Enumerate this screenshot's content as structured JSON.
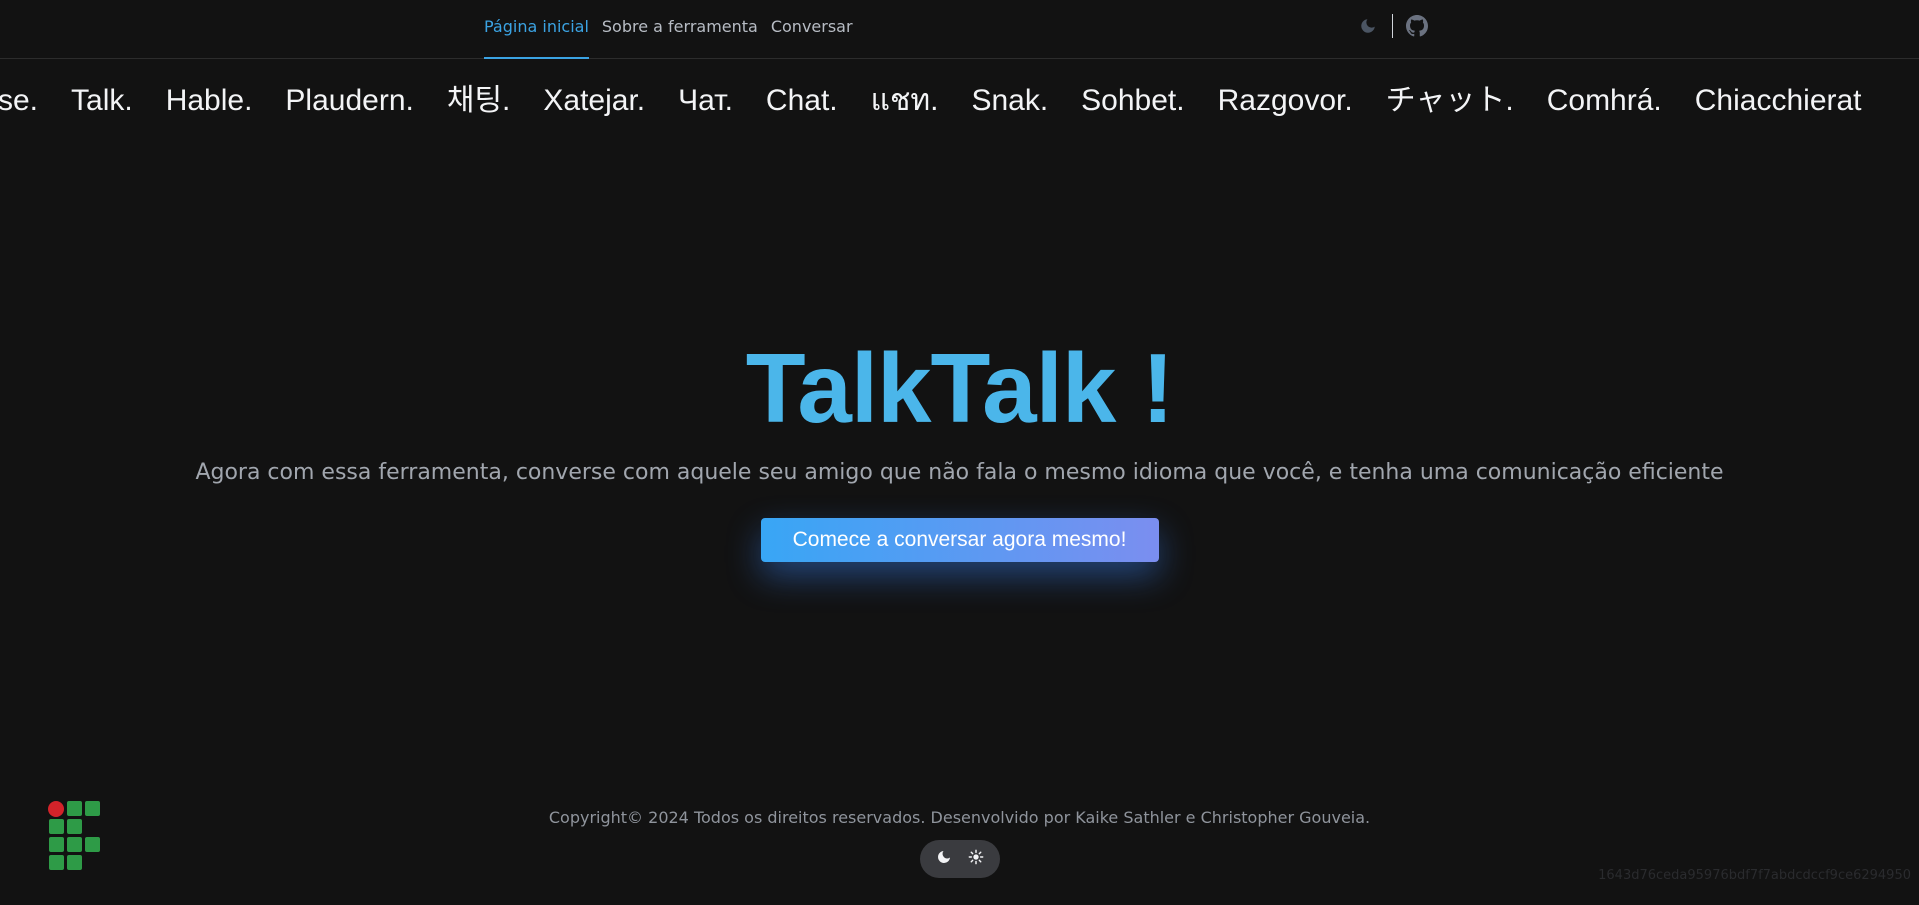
{
  "nav": {
    "links": [
      "Página inicial",
      "Sobre a ferramenta",
      "Conversar"
    ],
    "active_index": 0,
    "right_icons": [
      "moon-icon",
      "github-icon"
    ]
  },
  "marquee": {
    "words": [
      "rse.",
      "Talk.",
      "Hable.",
      "Plaudern.",
      "채팅.",
      "Xatejar.",
      "Чат.",
      "Chat.",
      "แชท.",
      "Snak.",
      "Sohbet.",
      "Razgovor.",
      "チャット.",
      "Comhrá.",
      "Chiacchierat"
    ]
  },
  "hero": {
    "title": "TalkTalk !",
    "subtitle": "Agora com essa ferramenta, converse com aquele seu amigo que não fala o mesmo idioma que você, e tenha uma comunicação eficiente",
    "cta_label": "Comece a conversar agora mesmo!"
  },
  "footer": {
    "copyright": "Copyright© 2024 Todos os direitos reservados. Desenvolvido por Kaike Sathler e Christopher Gouveia.",
    "theme_toggle_icons": [
      "moon-icon",
      "sun-icon"
    ],
    "hash": "1643d76ceda95976bdf7f7abdcdccf9ce6294950"
  },
  "colors": {
    "background": "#121212",
    "accent": "#3ba3e3",
    "title": "#4bb6ea",
    "cta_start": "#38a6f5",
    "cta_end": "#7b8ef0",
    "logo_green": "#2e9b47",
    "logo_red": "#d3232a"
  }
}
